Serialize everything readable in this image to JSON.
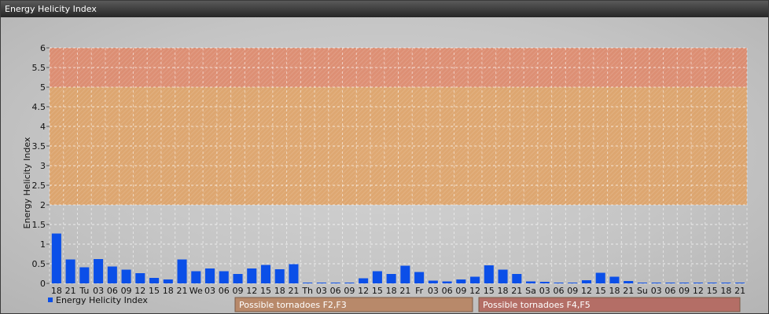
{
  "window": {
    "title": "Energy Helicity Index"
  },
  "chart_data": {
    "type": "bar",
    "ylabel": "Energy Helicity Index",
    "ylim": [
      0,
      6
    ],
    "yticks": [
      "0",
      "0.5",
      "1",
      "1.5",
      "2",
      "2.5",
      "3",
      "3.5",
      "4",
      "4.5",
      "5",
      "5.5",
      "6"
    ],
    "grid": true,
    "legend": {
      "position": "bottom-left",
      "label": "Energy Helicity Index"
    },
    "categories": [
      "18",
      "21",
      "Tu",
      "03",
      "06",
      "09",
      "12",
      "15",
      "18",
      "21",
      "We",
      "03",
      "06",
      "09",
      "12",
      "15",
      "18",
      "21",
      "Th",
      "03",
      "06",
      "09",
      "12",
      "15",
      "18",
      "21",
      "Fr",
      "03",
      "06",
      "09",
      "12",
      "15",
      "18",
      "21",
      "Sa",
      "03",
      "06",
      "09",
      "12",
      "15",
      "18",
      "21",
      "Su",
      "03",
      "06",
      "09",
      "12",
      "15",
      "18",
      "21"
    ],
    "series": [
      {
        "name": "Energy Helicity Index",
        "values": [
          1.27,
          0.61,
          0.41,
          0.62,
          0.43,
          0.35,
          0.26,
          0.14,
          0.1,
          0.61,
          0.31,
          0.38,
          0.31,
          0.24,
          0.38,
          0.47,
          0.36,
          0.49,
          0.02,
          0.02,
          0.02,
          0.02,
          0.13,
          0.31,
          0.24,
          0.45,
          0.29,
          0.07,
          0.05,
          0.1,
          0.17,
          0.46,
          0.35,
          0.24,
          0.05,
          0.04,
          0.02,
          0.02,
          0.08,
          0.27,
          0.17,
          0.06,
          0.02,
          0.02,
          0.02,
          0.02,
          0.02,
          0.02,
          0.02,
          0.02
        ]
      }
    ],
    "zones": [
      {
        "from": 2,
        "to": 5,
        "label": "Possible tornadoes F2,F3",
        "color": "#e0a060"
      },
      {
        "from": 5,
        "to": 6,
        "label": "Possible tornadoes F4,F5",
        "color": "#e08565"
      }
    ],
    "colors": {
      "bar": "#0b4fe8",
      "zone_low_legend": "#b8896a",
      "zone_high_legend": "#b46e66"
    }
  }
}
